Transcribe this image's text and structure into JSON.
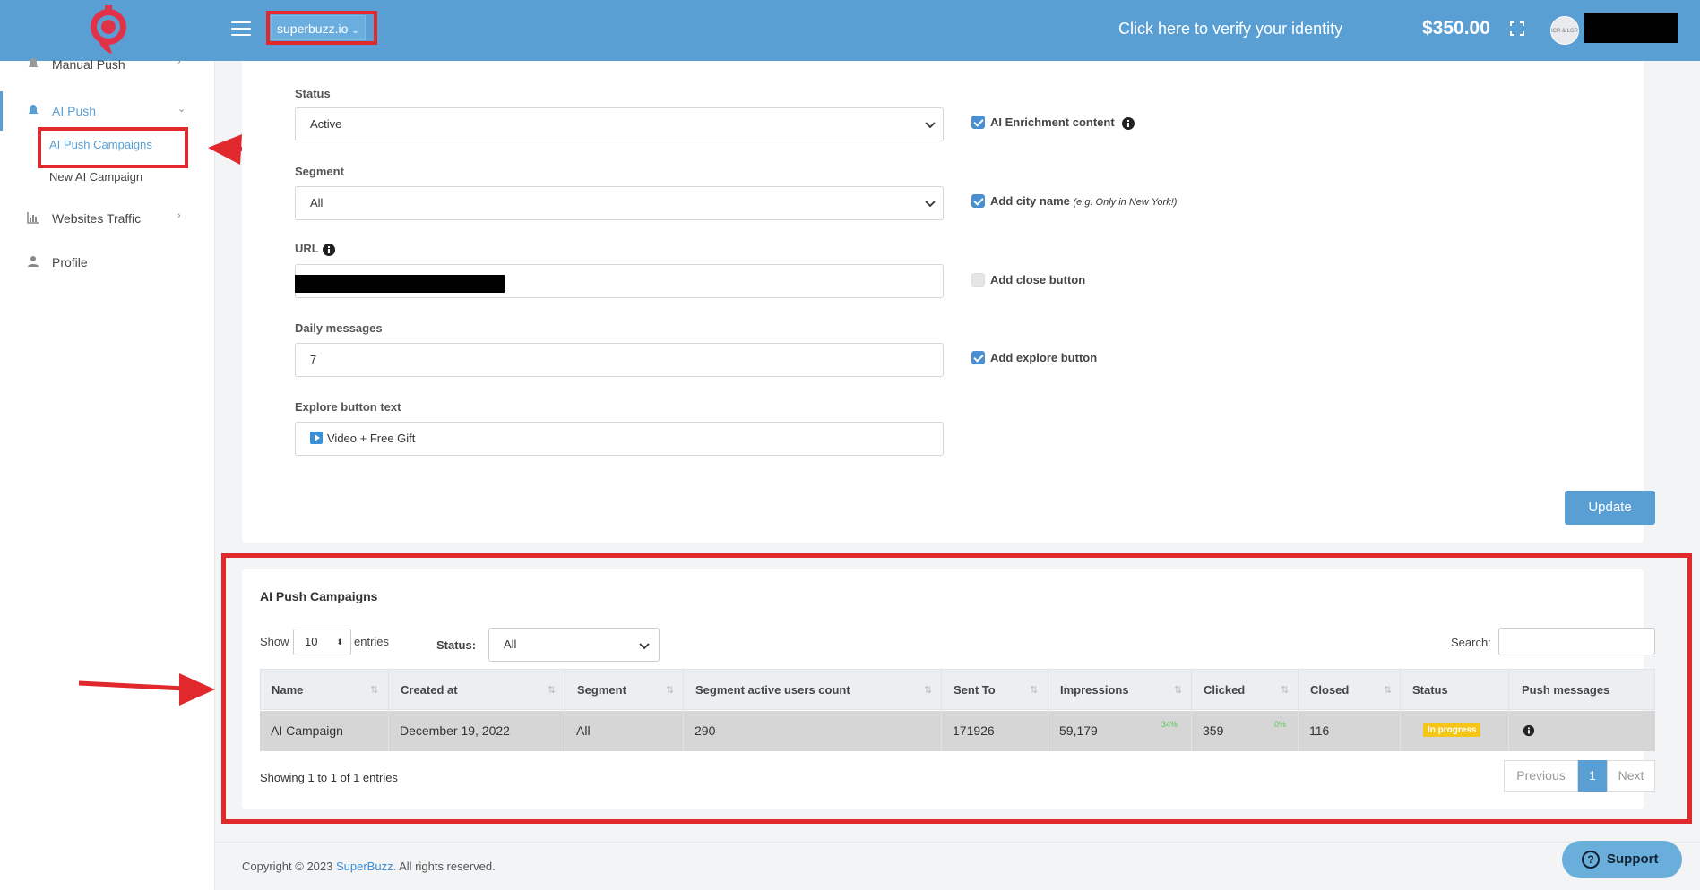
{
  "header": {
    "domain": "superbuzz.io",
    "verify_text": "Click here to verify your identity",
    "balance": "$350.00",
    "avatar_text": "ICR & LGR"
  },
  "sidebar": {
    "items": [
      {
        "label": "Manual Push"
      },
      {
        "label": "AI Push"
      },
      {
        "label": "Websites Traffic"
      },
      {
        "label": "Profile"
      }
    ],
    "sub_items": [
      {
        "label": "AI Push Campaigns"
      },
      {
        "label": "New AI Campaign"
      }
    ]
  },
  "form": {
    "status_label": "Status",
    "status_value": "Active",
    "segment_label": "Segment",
    "segment_value": "All",
    "url_label": "URL",
    "daily_label": "Daily messages",
    "daily_value": "7",
    "explore_label": "Explore button text",
    "explore_value": "Video + Free Gift",
    "checkboxes": [
      {
        "label": "AI Enrichment content",
        "checked": true
      },
      {
        "label": "Add city name",
        "hint": "(e.g: Only in New York!)",
        "checked": true
      },
      {
        "label": "Add close button",
        "checked": false
      },
      {
        "label": "Add explore button",
        "checked": true
      }
    ],
    "update_label": "Update"
  },
  "table_card": {
    "title": "AI Push Campaigns",
    "show_label": "Show",
    "entries_label": "entries",
    "length_value": "10",
    "status_label": "Status:",
    "status_value": "All",
    "search_label": "Search:",
    "columns": [
      "Name",
      "Created at",
      "Segment",
      "Segment active users count",
      "Sent To",
      "Impressions",
      "Clicked",
      "Closed",
      "Status",
      "Push messages"
    ],
    "rows": [
      {
        "name": "AI Campaign",
        "created_at": "December 19, 2022",
        "segment": "All",
        "active_users": "290",
        "sent_to": "171926",
        "impressions": "59,179",
        "impressions_pct": "34%",
        "clicked": "359",
        "clicked_pct": "0%",
        "closed": "116",
        "status": "In progress"
      }
    ],
    "showing_text": "Showing 1 to 1 of 1 entries",
    "pager": {
      "previous": "Previous",
      "current": "1",
      "next": "Next"
    }
  },
  "footer": {
    "copyright": "Copyright © 2023",
    "brand": "SuperBuzz.",
    "rights": "All rights reserved.",
    "support_label": "Support"
  },
  "colors": {
    "header": "#5a9fd4",
    "accent": "#5a9fd4",
    "annotation_red": "#e0282d",
    "badge": "#f5c518"
  }
}
